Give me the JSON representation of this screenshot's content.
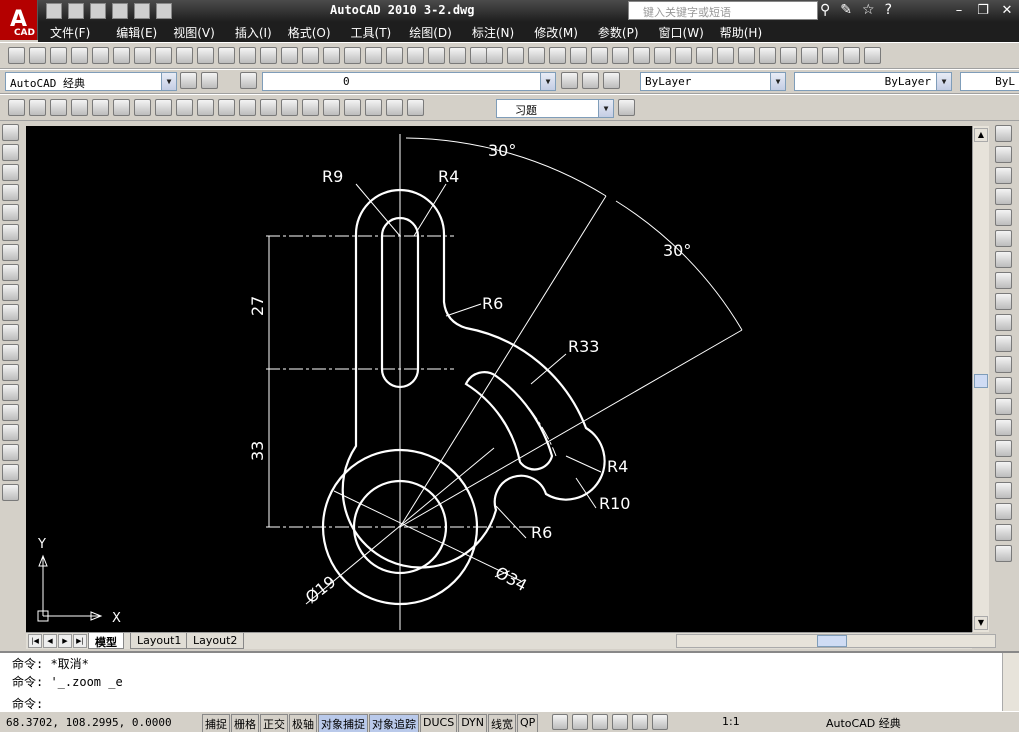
{
  "app": {
    "logo_letter": "A",
    "logo_sub": "CAD",
    "title": "AutoCAD 2010  3-2.dwg",
    "search_placeholder": "键入关键字或短语"
  },
  "menu": [
    "文件(F)",
    "编辑(E)",
    "视图(V)",
    "插入(I)",
    "格式(O)",
    "工具(T)",
    "绘图(D)",
    "标注(N)",
    "修改(M)",
    "参数(P)",
    "窗口(W)",
    "帮助(H)"
  ],
  "toolbar": {
    "workspace": "AutoCAD 经典",
    "layer": "0",
    "color": "ByLayer",
    "linetype": "ByLayer",
    "lineweight": "ByL",
    "dimstyle": "习题"
  },
  "drawing": {
    "dimensions": {
      "angle_top": "30°",
      "angle_mid": "30°",
      "r9": "R9",
      "r4_top": "R4",
      "r6_top": "R6",
      "r33": "R33",
      "r4_right": "R4",
      "r10": "R10",
      "r6_bottom": "R6",
      "d27": "27",
      "d33": "33",
      "dia19": "Ø19",
      "dia34": "Ø34"
    },
    "ucs": {
      "x_label": "X",
      "y_label": "Y"
    }
  },
  "tabs": [
    "模型",
    "Layout1",
    "Layout2"
  ],
  "command": {
    "line1": "命令: *取消*",
    "line2": "命令: '_.zoom _e",
    "line3": "命令:"
  },
  "status": {
    "coords": "68.3702,  108.2995, 0.0000",
    "toggles": [
      "捕捉",
      "栅格",
      "正交",
      "极轴",
      "对象捕捉",
      "对象追踪",
      "DUCS",
      "DYN",
      "线宽",
      "QP"
    ],
    "toggles_on": [
      false,
      false,
      false,
      false,
      true,
      true,
      false,
      false,
      false,
      false
    ],
    "scale": "1:1",
    "workspace": "AutoCAD 经典"
  }
}
